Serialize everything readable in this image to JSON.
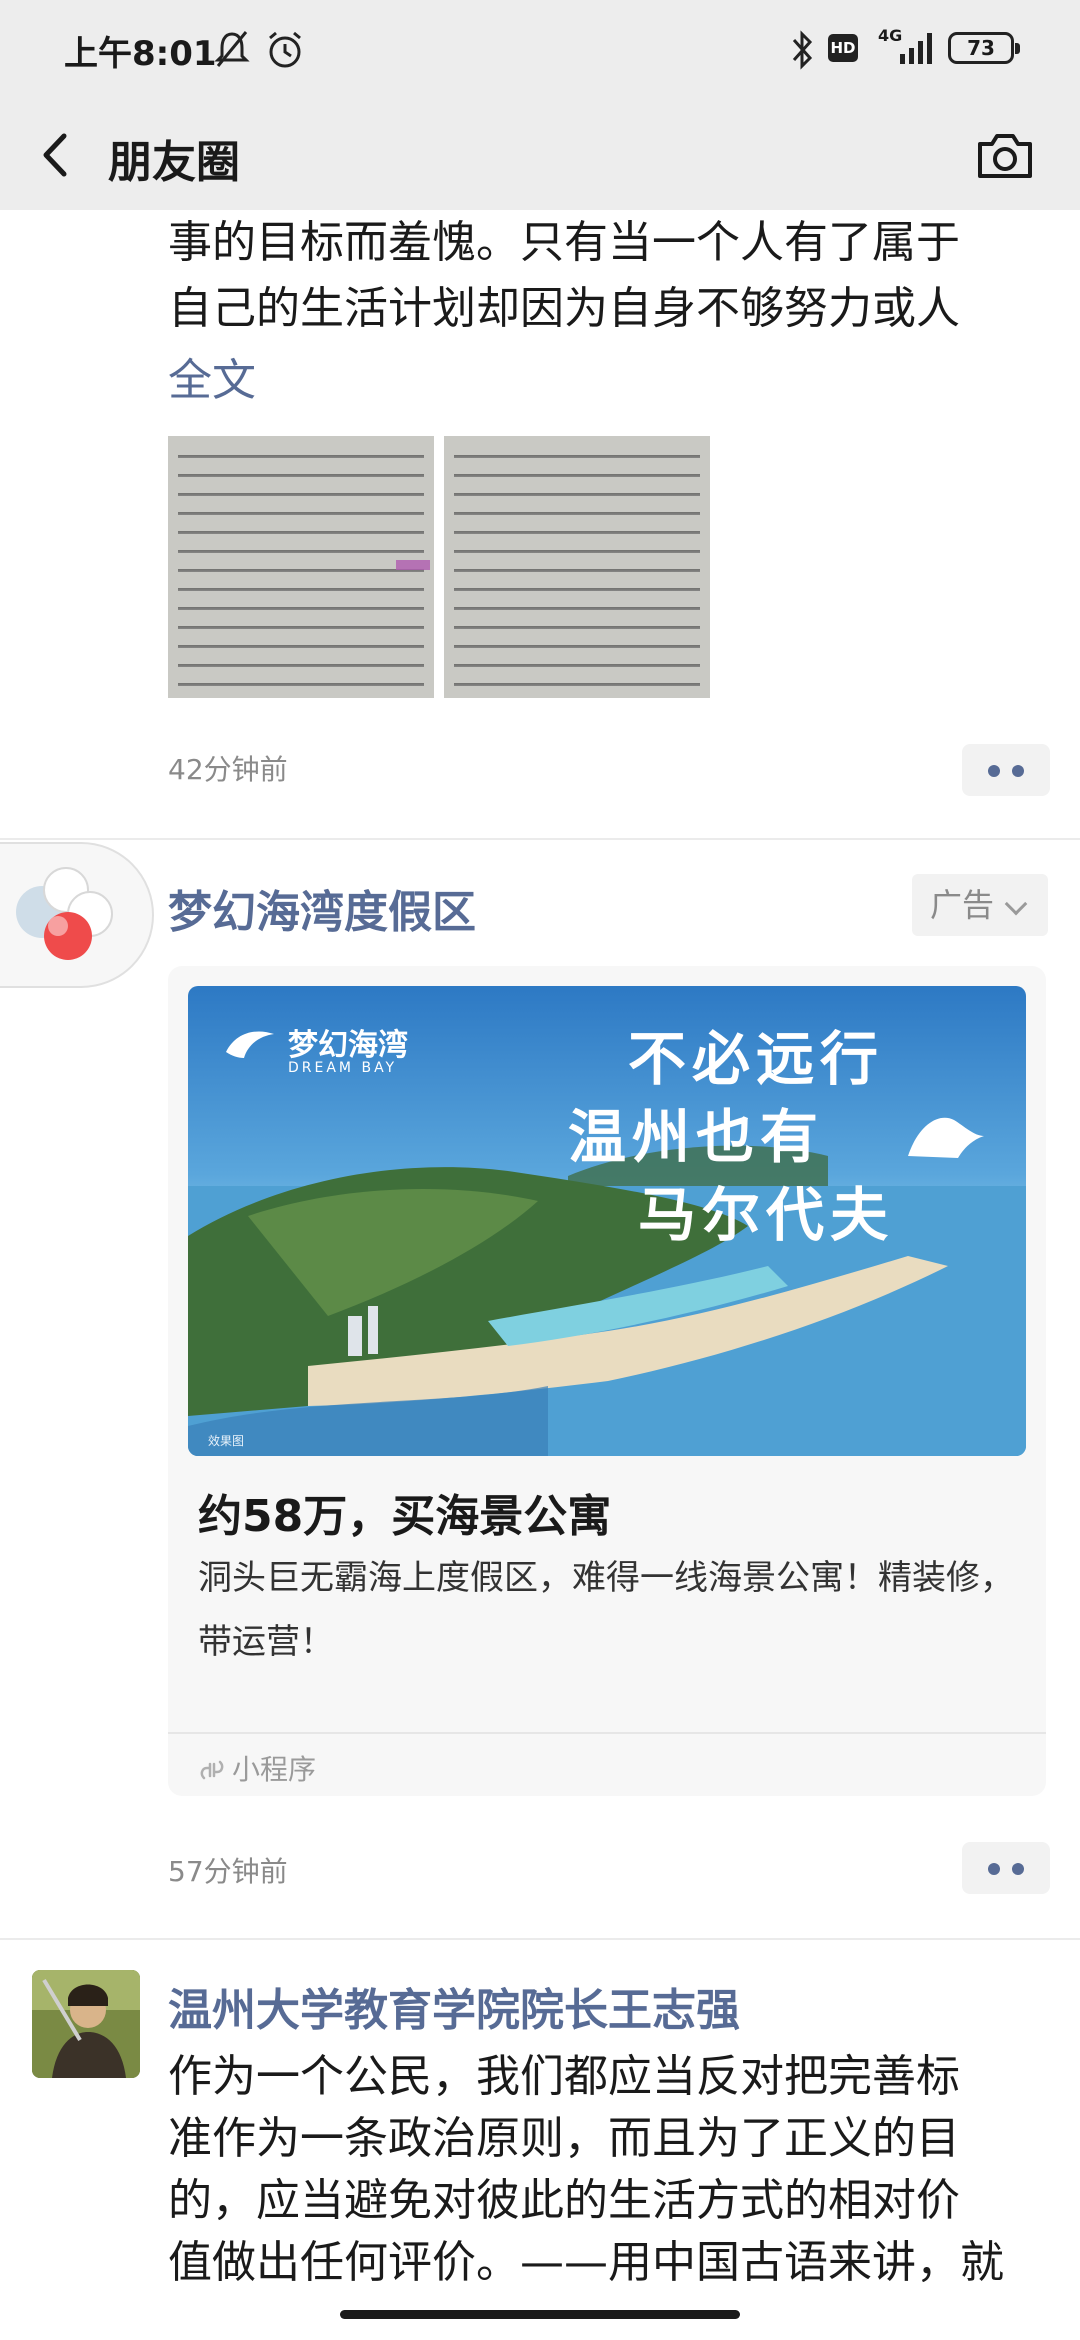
{
  "status_bar": {
    "time": "上午8:01",
    "network": "4G",
    "hd": "HD",
    "battery": "73"
  },
  "nav": {
    "title": "朋友圈"
  },
  "post1": {
    "text_lines": [
      "事的目标而羞愧。只有当一个人有了属于",
      "自己的生活计划却因为自身不够努力或人"
    ],
    "full_text_link": "全文",
    "time": "42分钟前"
  },
  "ad_post": {
    "name": "梦幻海湾度假区",
    "badge": "广告",
    "banner": {
      "brand": "梦幻海湾",
      "brand_en": "DREAM BAY",
      "slogan_lines": [
        "不必远行",
        "温州也有",
        "马尔代夫"
      ],
      "caption": "效果图"
    },
    "headline": "约58万，买海景公寓",
    "description": "洞头巨无霸海上度假区，难得一线海景公寓！精装修，带运营！",
    "footer": "小程序",
    "time": "57分钟前"
  },
  "post3": {
    "name": "温州大学教育学院院长王志强",
    "text_lines": [
      "作为一个公民，我们都应当反对把完善标",
      "准作为一条政治原则，而且为了正义的目",
      "的，应当避免对彼此的生活方式的相对价",
      "值做出任何评价。——用中国古语来讲，就"
    ]
  },
  "colors": {
    "link": "#576b95",
    "bar_bg": "#ededed"
  }
}
